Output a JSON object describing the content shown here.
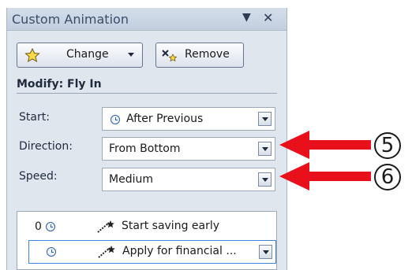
{
  "panel": {
    "title": "Custom Animation"
  },
  "toolbar": {
    "change_label": "Change",
    "remove_label": "Remove"
  },
  "modify": {
    "heading": "Modify: Fly In",
    "start_label": "Start:",
    "start_value": "After Previous",
    "direction_label": "Direction:",
    "direction_value": "From Bottom",
    "speed_label": "Speed:",
    "speed_value": "Medium"
  },
  "animation_list": [
    {
      "order": "0",
      "label": "Start saving early"
    },
    {
      "order": "",
      "label": "Apply for financial ..."
    }
  ],
  "callouts": {
    "direction": "5",
    "speed": "6"
  },
  "colors": {
    "panel_bg": "#dfe6ee",
    "title_text": "#3b4d68",
    "arrow_red": "#e8101a",
    "selection_border": "#3c86e0"
  },
  "icons": [
    "star-effect-icon",
    "remove-effect-icon",
    "clock-icon",
    "motion-path-icon",
    "dropdown-arrow-icon",
    "close-icon"
  ]
}
